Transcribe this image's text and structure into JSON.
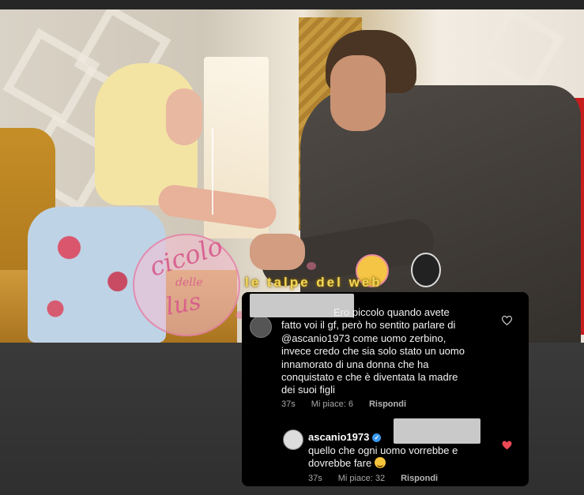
{
  "watermarks": {
    "circle_top": "cicolo",
    "circle_mid": "delle",
    "circle_bottom": "lus",
    "talpe": "le talpe del web"
  },
  "comment1": {
    "text_lines": [
      "Ero piccolo quando avete",
      "fatto voi il gf, però ho sentito parlare di",
      "@ascanio1973 come uomo zerbino,",
      "invece credo che sia solo stato un uomo",
      "innamorato di una donna che ha",
      "conquistato e che è diventata la madre",
      "dei suoi figli"
    ],
    "time": "37s",
    "likes": "Mi piace: 6",
    "reply": "Rispondi",
    "heart_icon": "heart-outline-icon"
  },
  "comment2": {
    "username": "ascanio1973",
    "verified_icon": "verified-badge-icon",
    "text_lines": [
      "quello che ogni uomo vorrebbe e",
      "dovrebbe fare"
    ],
    "emoji_icon": "smiling-face-icon",
    "time": "37s",
    "likes": "Mi piace: 32",
    "reply": "Rispondi",
    "heart_icon": "heart-filled-icon",
    "heart_color": "#ed4956"
  }
}
